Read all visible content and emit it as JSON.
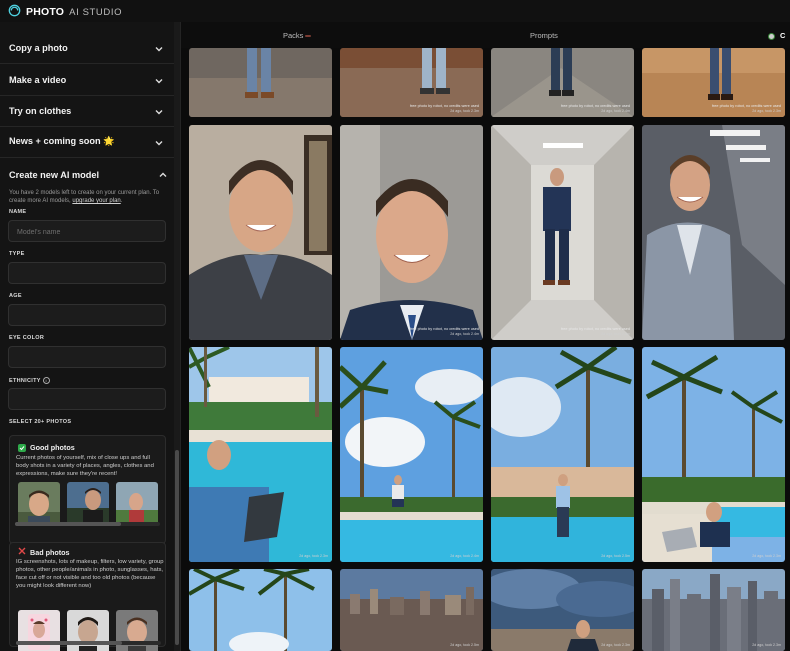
{
  "app": {
    "name": "PHOTO",
    "name_suffix": "AI STUDIO"
  },
  "sidebar": {
    "sections": [
      {
        "label": "Copy a photo"
      },
      {
        "label": "Make a video"
      },
      {
        "label": "Try on clothes"
      },
      {
        "label": "News + coming soon 🌟"
      }
    ],
    "create_model": {
      "title": "Create new AI model",
      "description_pre": "You have 2 models left to create on your current plan. To create more AI models, ",
      "description_link": "upgrade your plan",
      "description_post": ".",
      "fields": {
        "name_label": "NAME",
        "name_placeholder": "Model's name",
        "type_label": "TYPE",
        "age_label": "AGE",
        "eye_color_label": "EYE COLOR",
        "ethnicity_label": "ETHNICITY"
      },
      "select_photos_label": "SELECT 20+ PHOTOS",
      "good_photos": {
        "title": "Good photos",
        "text": "Current photos of yourself, mix of close ups and full body shots in a variety of places, angles, clothes and expressions, make sure they're recent!"
      },
      "bad_photos": {
        "title": "Bad photos",
        "text": "IG screenshots, lots of makeup, filters, low variety, group photos, other people/animals in photo, sunglasses, hats, face cut off or not visible and too old photos (because you might look different now)"
      }
    }
  },
  "tabs": [
    {
      "label": "Packs",
      "badge": "NEW"
    },
    {
      "label": "Prompts"
    },
    {
      "label": "C"
    }
  ],
  "gallery": {
    "caption_line1": "free photo by robot, no credits were used",
    "captions_line2": [
      "2d ago, took 2.3m",
      "2d ago, took 2.4m",
      "2d ago, took 2.3m",
      "2d ago, took 2.4m",
      "2d ago, took 2.3m",
      "2d ago, took 2.3m",
      "2d ago, took 2.4m",
      "2d ago, took 2.5m",
      "2d ago, took 2.3m",
      "2d ago, took 2.5m",
      "2d ago, took 2.3m",
      "2d ago, took 2.3m"
    ]
  },
  "colors": {
    "background": "#0b0b0b",
    "sidebar": "#141414",
    "good_badge": "#2eaa4a",
    "bad_mark": "#e04848"
  }
}
